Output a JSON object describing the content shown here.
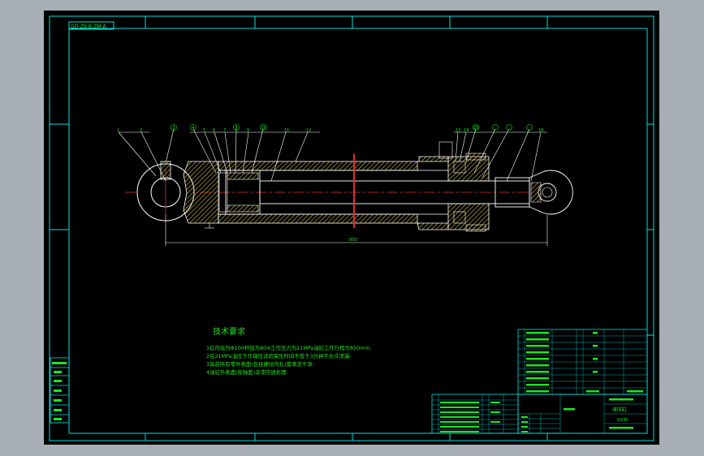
{
  "title_block": {
    "drawing_number": "GO-ZB-B-ZM-A",
    "tech_requirements_title": "技术要求",
    "tech_requirements": [
      "1缸内径为Φ100杆径为Φ56工作压力为21MPa油缸工作行程为850mm;",
      "2在21MPa油压下作保压试验保压时间不低于3分钟不允许渗漏;",
      "3装前所有零件表面(包括螺纹内孔)需清洗干净;",
      "4油缸外表面(除轴套)涂漆防锈处理."
    ],
    "dimension_label": "850",
    "balloons": [
      "1",
      "2",
      "3",
      "4",
      "5",
      "6",
      "7",
      "8",
      "9",
      "10",
      "11",
      "12",
      "13",
      "14",
      "15",
      "16"
    ],
    "sheet_name": "液压缸",
    "material_label": "Q235"
  },
  "colors": {
    "background": "#000000",
    "border": "#00e0e0",
    "outline": "#ffffff",
    "hatch": "#d4c040",
    "centerline": "#e03030",
    "text": "#21e421",
    "leader": "#ffffff",
    "chrome": "#a8aeb6"
  }
}
